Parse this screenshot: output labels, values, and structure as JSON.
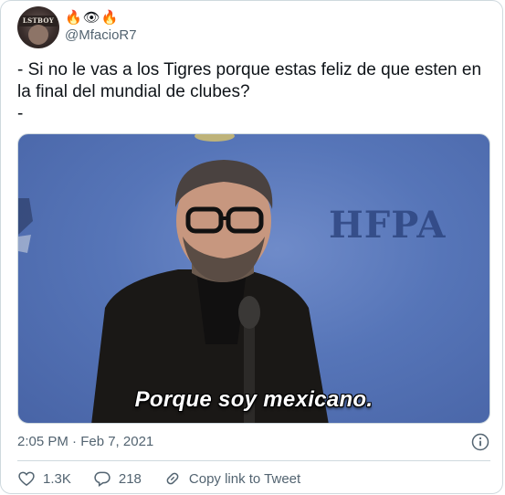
{
  "tweet": {
    "display_name_emojis": [
      "🔥",
      "👁",
      "🔥"
    ],
    "avatar_text": "LSTBOY",
    "handle": "@MfacioR7",
    "text": "- Si no le vas a los Tigres porque estas feliz de que esten en la final del mundial de clubes?\n-",
    "media": {
      "subtitle": "Porque soy mexicano.",
      "backdrop_text": "HFPA"
    },
    "timestamp": "2:05 PM · Feb 7, 2021"
  },
  "actions": {
    "likes": "1.3K",
    "replies": "218",
    "copy_link": "Copy link to Tweet"
  },
  "icons": {
    "info": "info-icon",
    "like": "heart-icon",
    "reply": "reply-icon",
    "link": "link-icon"
  },
  "colors": {
    "secondary_text": "#536471",
    "border": "#cfd9de",
    "backdrop_blue": "#5675b8"
  }
}
